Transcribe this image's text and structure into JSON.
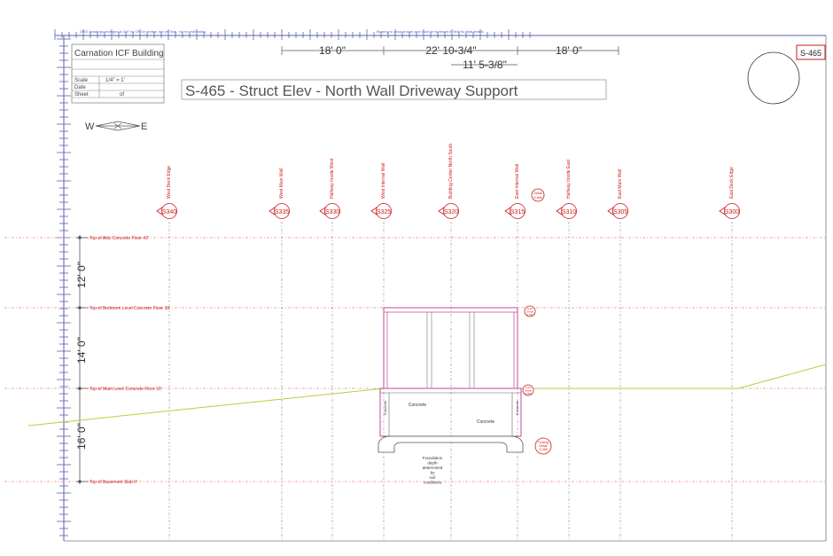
{
  "title_block": {
    "project": "Carnation ICF Building",
    "scale_label": "Scale",
    "scale_value": "1/4\" = 1'",
    "date_label": "Date",
    "sheet_label": "Sheet",
    "sheet_of": "of"
  },
  "sheet_tag": "S-465",
  "drawing_title": "S-465 - Struct Elev - North Wall Driveway Support",
  "top_notes": {
    "left": "DWG drawings enlarged to 3/8\" by OK for review, not yet final, not for estimating",
    "right": "Bearing to ground work and shall be reviewed in field for final details"
  },
  "top_dims": [
    "18' 0\"",
    "22' 10-3/4\"",
    "18' 0\""
  ],
  "sub_dim": "11' 5-3/8\"",
  "compass": {
    "west": "W",
    "east": "E"
  },
  "grid_labels": [
    {
      "id": "S340",
      "name": "West Deck Edge"
    },
    {
      "id": "S335",
      "name": "West Main Wall"
    },
    {
      "id": "S330",
      "name": "Halfway Inside West"
    },
    {
      "id": "S325",
      "name": "West Internal Wall"
    },
    {
      "id": "S320",
      "name": "Building Center North South"
    },
    {
      "id": "S315",
      "name": "East Internal Wall"
    },
    {
      "id": "S310",
      "name": "Halfway Inside East"
    },
    {
      "id": "S305",
      "name": "East Main Wall"
    },
    {
      "id": "S300",
      "name": "East Deck Edge"
    }
  ],
  "detail_tag": {
    "text1": "Detail",
    "text2": "S-###"
  },
  "levels": [
    {
      "name": "Top of Attic Concrete Floor 42'"
    },
    {
      "name": "Top of Bedroom Level Concrete Floor 30'"
    },
    {
      "name": "Top of Main Level Concrete Floor 16'"
    },
    {
      "name": "Top of Basement Slab 0'"
    }
  ],
  "vert_dims": [
    "12' 0\"",
    "14' 0\"",
    "16' 0\""
  ],
  "structure": {
    "concrete_label_1": "Concrete",
    "concrete_label_2": "Concrete",
    "left_wall_label": "Concrete",
    "right_wall_label": "Concrete",
    "foundation_note": [
      "Foundation",
      "depth",
      "determined",
      "by",
      "soil",
      "conditions"
    ],
    "footing_tag": [
      "Footing",
      "Detail",
      "S-055"
    ],
    "tag_upper": [
      "S-10",
      "Detail",
      "S-055"
    ],
    "tag_lower": [
      "S-10",
      "Detail",
      "S-055"
    ]
  },
  "colors": {
    "red": "#cc1a1a",
    "magenta": "#c0489a",
    "ground": "#b6cf3c",
    "grid_h": "#e88a8a",
    "grid_v": "#a8a8a8",
    "border": "#5a5fb0"
  }
}
